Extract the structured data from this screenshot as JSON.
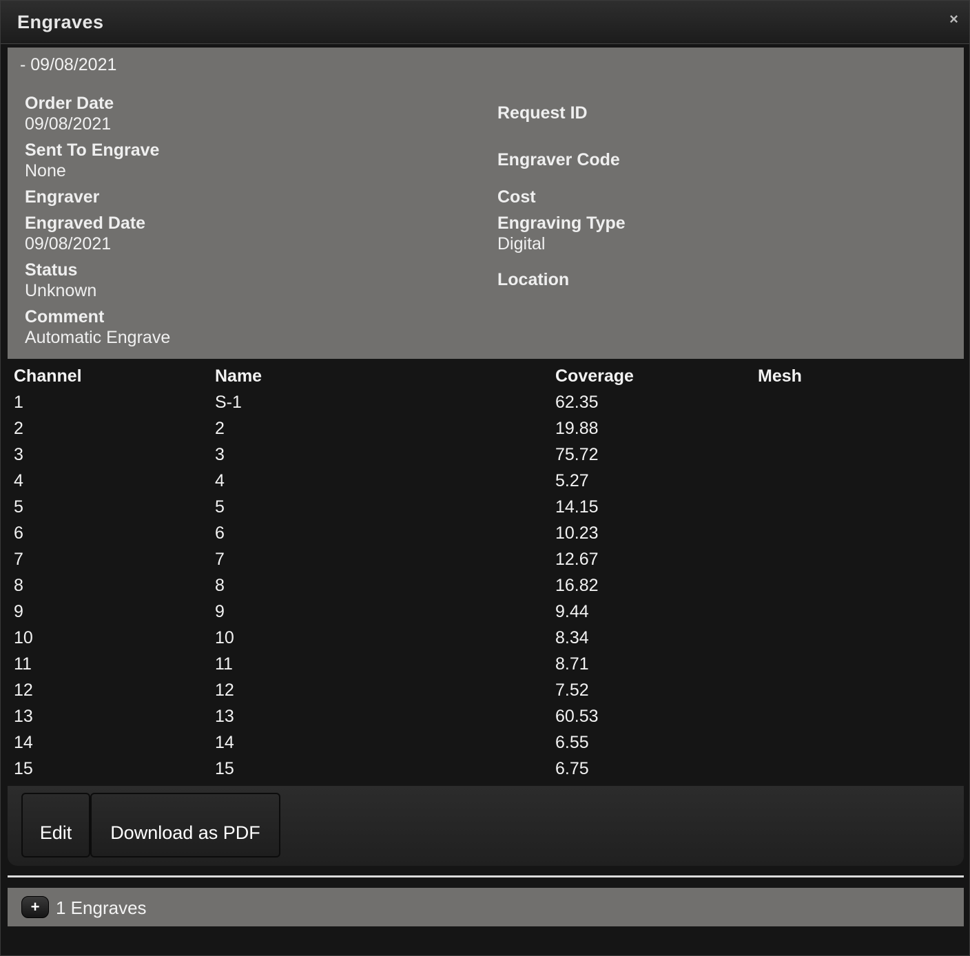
{
  "dialog": {
    "title": "Engraves",
    "close_symbol": "×"
  },
  "info": {
    "header": "- 09/08/2021",
    "left_fields": [
      {
        "label": "Order Date",
        "value": "09/08/2021"
      },
      {
        "label": "Sent To Engrave",
        "value": "None"
      },
      {
        "label": "Engraver",
        "value": ""
      },
      {
        "label": "Engraved Date",
        "value": "09/08/2021"
      },
      {
        "label": "Status",
        "value": "Unknown"
      },
      {
        "label": "Comment",
        "value": "Automatic Engrave"
      }
    ],
    "right_fields": [
      {
        "label": "Request ID",
        "value": ""
      },
      {
        "label": "Engraver Code",
        "value": ""
      },
      {
        "label": "Cost",
        "value": ""
      },
      {
        "label": "Engraving Type",
        "value": "Digital"
      },
      {
        "label": "Location",
        "value": ""
      }
    ]
  },
  "table": {
    "headers": [
      "Channel",
      "Name",
      "Coverage",
      "Mesh"
    ],
    "rows": [
      [
        "1",
        "S-1",
        "62.35",
        ""
      ],
      [
        "2",
        "2",
        "19.88",
        ""
      ],
      [
        "3",
        "3",
        "75.72",
        ""
      ],
      [
        "4",
        "4",
        "5.27",
        ""
      ],
      [
        "5",
        "5",
        "14.15",
        ""
      ],
      [
        "6",
        "6",
        "10.23",
        ""
      ],
      [
        "7",
        "7",
        "12.67",
        ""
      ],
      [
        "8",
        "8",
        "16.82",
        ""
      ],
      [
        "9",
        "9",
        "9.44",
        ""
      ],
      [
        "10",
        "10",
        "8.34",
        ""
      ],
      [
        "11",
        "11",
        "8.71",
        ""
      ],
      [
        "12",
        "12",
        "7.52",
        ""
      ],
      [
        "13",
        "13",
        "60.53",
        ""
      ],
      [
        "14",
        "14",
        "6.55",
        ""
      ],
      [
        "15",
        "15",
        "6.75",
        ""
      ]
    ]
  },
  "actions": {
    "edit_label": "Edit",
    "pdf_label": "Download as PDF"
  },
  "summary": {
    "expand_symbol": "+",
    "text": "1 Engraves"
  }
}
